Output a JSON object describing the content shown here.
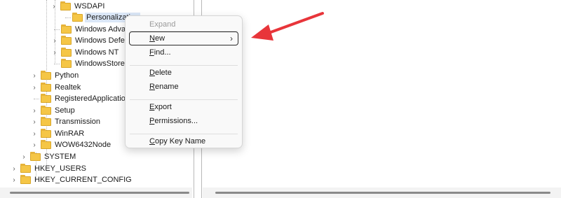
{
  "tree": {
    "nodes": [
      {
        "label": "WSDAPI",
        "expander": "›",
        "icon": "folder-icon"
      },
      {
        "label": "Personalization",
        "expander": "",
        "icon": "folder-icon",
        "selected": true
      },
      {
        "label": "Windows Advanced Installer",
        "expander": "",
        "icon": "folder-icon"
      },
      {
        "label": "Windows Defender",
        "expander": "›",
        "icon": "folder-icon"
      },
      {
        "label": "Windows NT",
        "expander": "›",
        "icon": "folder-icon"
      },
      {
        "label": "WindowsStore",
        "expander": "",
        "icon": "folder-icon"
      },
      {
        "label": "Python",
        "expander": "›",
        "icon": "folder-icon"
      },
      {
        "label": "Realtek",
        "expander": "›",
        "icon": "folder-icon"
      },
      {
        "label": "RegisteredApplications",
        "expander": "",
        "icon": "folder-icon"
      },
      {
        "label": "Setup",
        "expander": "›",
        "icon": "folder-icon"
      },
      {
        "label": "Transmission",
        "expander": "›",
        "icon": "folder-icon"
      },
      {
        "label": "WinRAR",
        "expander": "›",
        "icon": "folder-icon"
      },
      {
        "label": "WOW6432Node",
        "expander": "›",
        "icon": "folder-icon"
      },
      {
        "label": "SYSTEM",
        "expander": "›",
        "icon": "folder-icon"
      },
      {
        "label": "HKEY_USERS",
        "expander": "›",
        "icon": "folder-icon"
      },
      {
        "label": "HKEY_CURRENT_CONFIG",
        "expander": "›",
        "icon": "folder-icon"
      }
    ]
  },
  "context_menu": {
    "items": [
      {
        "type": "item",
        "label": "Expand",
        "enabled": false
      },
      {
        "type": "separator"
      },
      {
        "type": "item",
        "label": "New",
        "accel": "N",
        "has_submenu": true,
        "submenu_glyph": "›",
        "focused": true
      },
      {
        "type": "item",
        "label": "Find...",
        "accel": "F"
      },
      {
        "type": "separator"
      },
      {
        "type": "item",
        "label": "Delete",
        "accel": "D"
      },
      {
        "type": "item",
        "label": "Rename",
        "accel": "R"
      },
      {
        "type": "separator"
      },
      {
        "type": "item",
        "label": "Export",
        "accel": "E"
      },
      {
        "type": "item",
        "label": "Permissions...",
        "accel": "P"
      },
      {
        "type": "separator"
      },
      {
        "type": "item",
        "label": "Copy Key Name",
        "accel": "C"
      }
    ]
  },
  "annotation": {
    "icon": "arrow-pointer-icon",
    "color": "#e8353a"
  },
  "colors": {
    "folder": "#f5c646",
    "selection": "#dbe7f7",
    "menu_background": "#f9f9f9"
  }
}
